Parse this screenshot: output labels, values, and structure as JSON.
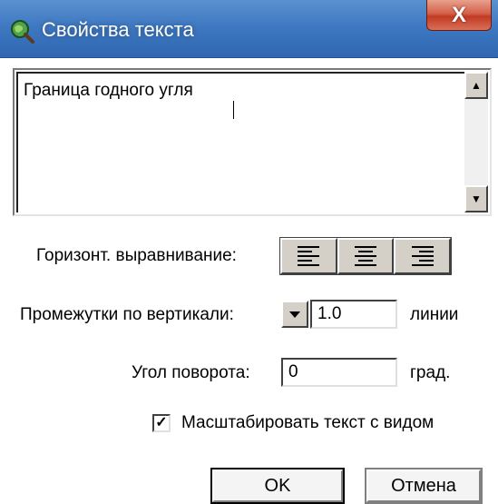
{
  "window": {
    "title": "Свойства текста",
    "close_label": "X"
  },
  "text_input": {
    "value": "Граница годного угля"
  },
  "alignment": {
    "label": "Горизонт. выравнивание:",
    "options": [
      "left",
      "center",
      "right"
    ]
  },
  "spacing": {
    "label": "Промежутки по вертикали:",
    "value": "1.0",
    "unit": "линии"
  },
  "rotation": {
    "label": "Угол поворота:",
    "value": "0",
    "unit": "град."
  },
  "scale": {
    "label": "Масштабировать текст с видом",
    "checked": true,
    "mark": "✓"
  },
  "buttons": {
    "ok": "OK",
    "cancel": "Отмена"
  },
  "icons": {
    "app": "globe-magnifier-icon",
    "scroll_up": "▲",
    "scroll_down": "▼"
  },
  "colors": {
    "titlebar": "#3f79c2",
    "close": "#c23a22"
  }
}
